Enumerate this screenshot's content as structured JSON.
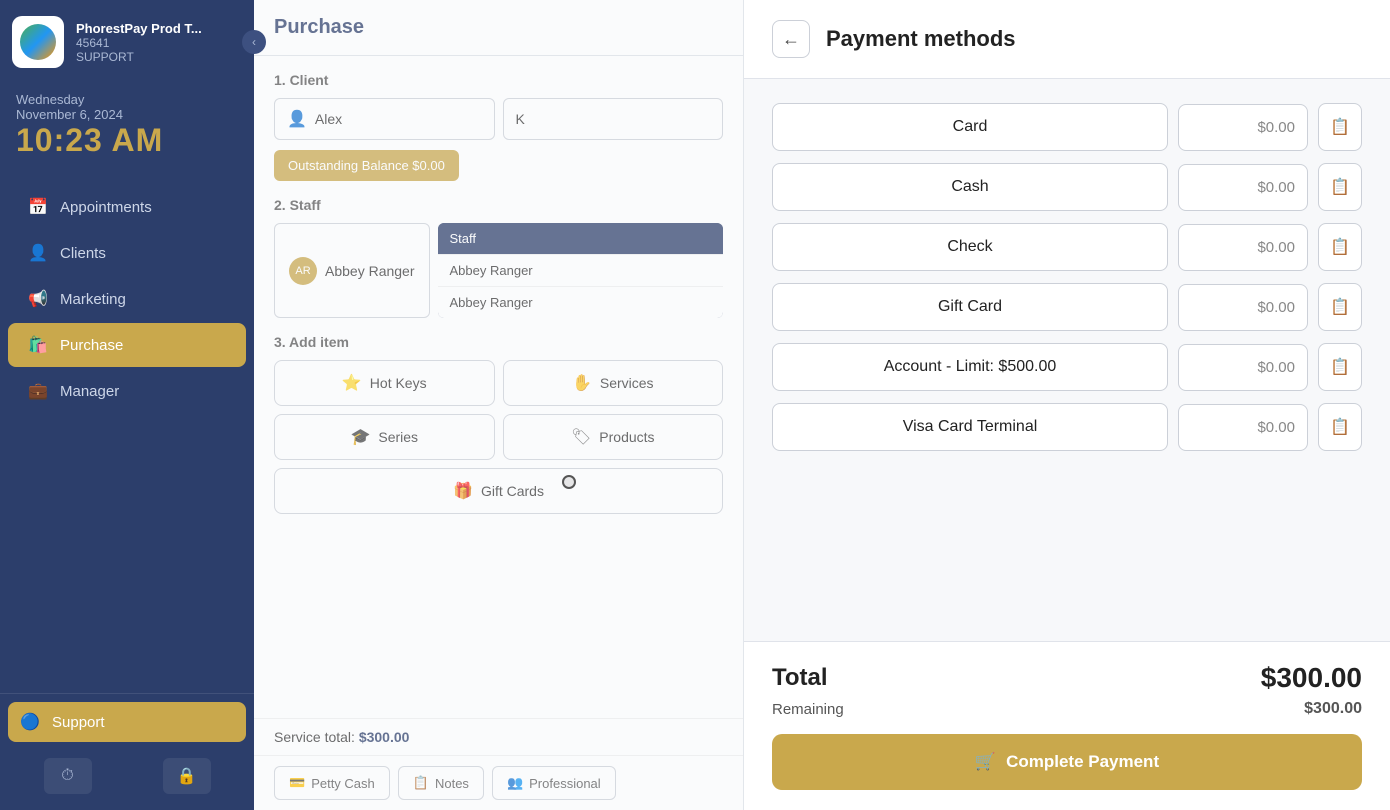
{
  "app": {
    "title": "PhorestPay Prod T...",
    "id": "45641",
    "role": "SUPPORT"
  },
  "sidebar": {
    "day": "Wednesday",
    "date": "November 6, 2024",
    "time": "10:23 AM",
    "nav_items": [
      {
        "id": "appointments",
        "label": "Appointments",
        "icon": "📅",
        "active": false
      },
      {
        "id": "clients",
        "label": "Clients",
        "icon": "👤",
        "active": false
      },
      {
        "id": "marketing",
        "label": "Marketing",
        "icon": "📢",
        "active": false
      },
      {
        "id": "purchase",
        "label": "Purchase",
        "icon": "🛍️",
        "active": true
      },
      {
        "id": "manager",
        "label": "Manager",
        "icon": "💼",
        "active": false
      }
    ],
    "support_label": "Support",
    "footer_icons": [
      "⏱",
      "🔒"
    ]
  },
  "purchase": {
    "title": "Purchase",
    "section_client": "1. Client",
    "client_first": "Alex",
    "client_last": "K",
    "balance_label": "Outstanding Balance $0.00",
    "section_staff": "2. Staff",
    "staff_name": "Abbey Ranger",
    "staff_column": "Staff",
    "staff_rows": [
      "Abbey Ranger",
      "Abbey Ranger"
    ],
    "section_add_item": "3. Add item",
    "add_item_buttons": [
      {
        "id": "hot-keys",
        "label": "Hot Keys",
        "icon": "⭐"
      },
      {
        "id": "services",
        "label": "Services",
        "icon": "✋"
      },
      {
        "id": "series",
        "label": "Series",
        "icon": "🎓"
      },
      {
        "id": "products",
        "label": "Products",
        "icon": "🏷"
      },
      {
        "id": "gift-cards",
        "label": "Gift Cards",
        "icon": "🎁"
      }
    ],
    "service_total": "Service total:",
    "service_total_amount": "$300.00",
    "footer_tabs": [
      {
        "id": "petty-cash",
        "label": "Petty Cash",
        "icon": "💳"
      },
      {
        "id": "notes",
        "label": "Notes",
        "icon": "📋"
      },
      {
        "id": "professional",
        "label": "Professional",
        "icon": "👥"
      }
    ]
  },
  "payment": {
    "back_icon": "←",
    "title": "Payment methods",
    "methods": [
      {
        "id": "card",
        "label": "Card",
        "amount": "$0.00"
      },
      {
        "id": "cash",
        "label": "Cash",
        "amount": "$0.00"
      },
      {
        "id": "check",
        "label": "Check",
        "amount": "$0.00"
      },
      {
        "id": "gift-card",
        "label": "Gift Card",
        "amount": "$0.00"
      },
      {
        "id": "account",
        "label": "Account - Limit: $500.00",
        "amount": "$0.00"
      },
      {
        "id": "visa-card-terminal",
        "label": "Visa Card Terminal",
        "amount": "$0.00"
      }
    ],
    "copy_icon": "📋",
    "total_label": "Total",
    "total_amount": "$300.00",
    "remaining_label": "Remaining",
    "remaining_amount": "$300.00",
    "complete_btn_label": "Complete Payment",
    "complete_btn_icon": "🛒"
  }
}
